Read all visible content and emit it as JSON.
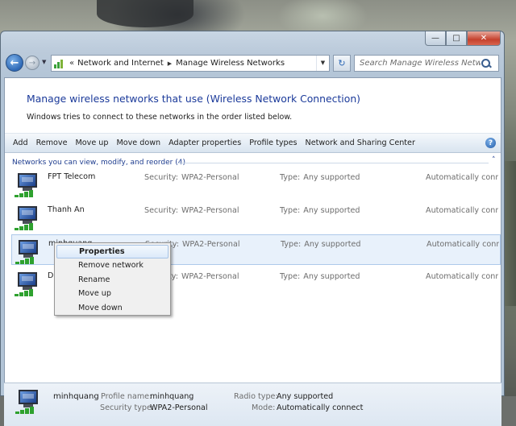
{
  "window": {
    "caption": {
      "minimize_glyph": "—",
      "maximize_glyph": "□",
      "close_glyph": "✕"
    }
  },
  "nav": {
    "back_glyph": "←",
    "forward_glyph": "→",
    "history_glyph": "▼",
    "breadcrumb_prefix": "«",
    "breadcrumb": [
      "Network and Internet",
      "Manage Wireless Networks"
    ],
    "crumb_arrow": "▶",
    "dropdown_glyph": "▼",
    "refresh_glyph": "↻",
    "search_placeholder": "Search Manage Wireless Networks"
  },
  "header": {
    "title": "Manage wireless networks that use (Wireless Network Connection)",
    "subtitle": "Windows tries to connect to these networks in the order listed below."
  },
  "toolbar": {
    "items": [
      "Add",
      "Remove",
      "Move up",
      "Move down",
      "Adapter properties",
      "Profile types",
      "Network and Sharing Center"
    ],
    "help_glyph": "?"
  },
  "group": {
    "label": "Networks you can view, modify, and reorder (4)",
    "collapse_glyph": "˄"
  },
  "labels": {
    "security": "Security:",
    "type": "Type:"
  },
  "networks": [
    {
      "name": "FPT Telecom",
      "security": "WPA2-Personal",
      "type": "Any supported",
      "mode": "Automatically conne..."
    },
    {
      "name": "Thanh An",
      "security": "WPA2-Personal",
      "type": "Any supported",
      "mode": "Automatically conne..."
    },
    {
      "name": "minhquang",
      "security": "WPA2-Personal",
      "type": "Any supported",
      "mode": "Automatically conne..."
    },
    {
      "name": "Dinh",
      "security": "WPA2-Personal",
      "type": "Any supported",
      "mode": "Automatically conne..."
    }
  ],
  "context_menu": {
    "items": [
      "Properties",
      "Remove network",
      "Rename",
      "Move up",
      "Move down"
    ]
  },
  "details": {
    "name": "minhquang",
    "profile_name_label": "Profile name:",
    "profile_name": "minhquang",
    "security_type_label": "Security type:",
    "security_type": "WPA2-Personal",
    "radio_type_label": "Radio type:",
    "radio_type": "Any supported",
    "mode_label": "Mode:",
    "mode": "Automatically connect"
  },
  "colors": {
    "accent": "#1b3a9a",
    "signal": "#2ea12e",
    "selection": "#e8f1fb"
  }
}
